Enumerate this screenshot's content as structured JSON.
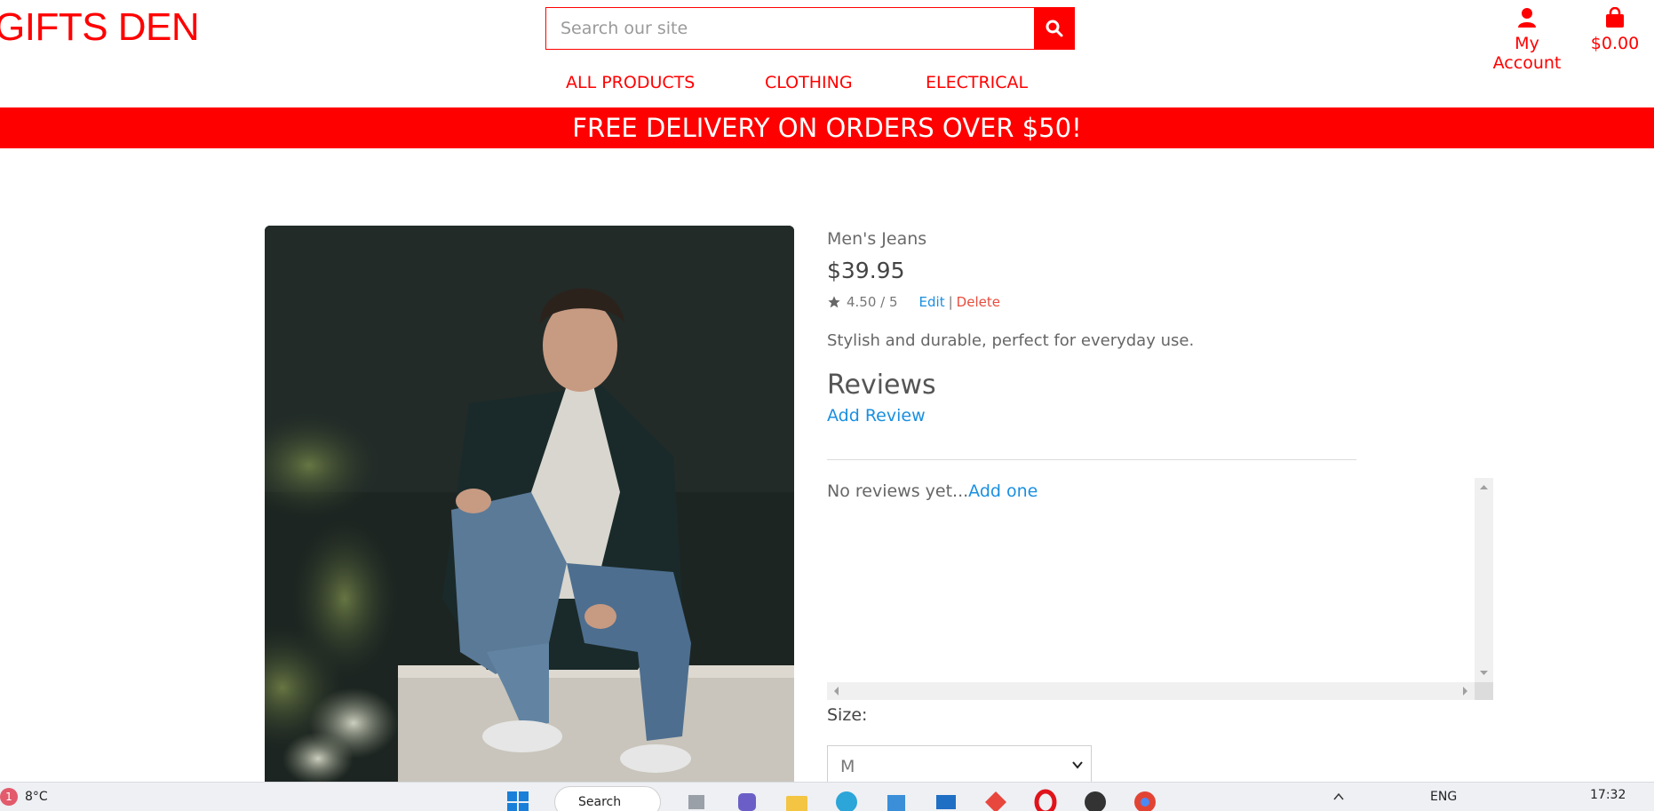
{
  "header": {
    "logo": "GIFTS DEN",
    "search_placeholder": "Search our site",
    "account_label": "My Account",
    "bag_total": "$0.00"
  },
  "nav": {
    "items": [
      "ALL PRODUCTS",
      "CLOTHING",
      "ELECTRICAL"
    ]
  },
  "banner": "FREE DELIVERY ON ORDERS OVER $50!",
  "product": {
    "name": "Men's Jeans",
    "price": "$39.95",
    "rating": "4.50 / 5",
    "edit_label": "Edit",
    "delete_label": "Delete",
    "description": "Stylish and durable, perfect for everyday use."
  },
  "reviews": {
    "heading": "Reviews",
    "add_review": "Add Review",
    "empty_text": "No reviews yet...",
    "add_one": "Add one"
  },
  "size": {
    "label": "Size:",
    "selected": "M"
  },
  "taskbar": {
    "notification_count": "1",
    "weather": "8°C",
    "search_label": "Search",
    "language": "ENG",
    "time": "17:32"
  },
  "colors": {
    "brand": "#ff0000",
    "link": "#1a8fe0",
    "delete": "#e74c3c"
  }
}
